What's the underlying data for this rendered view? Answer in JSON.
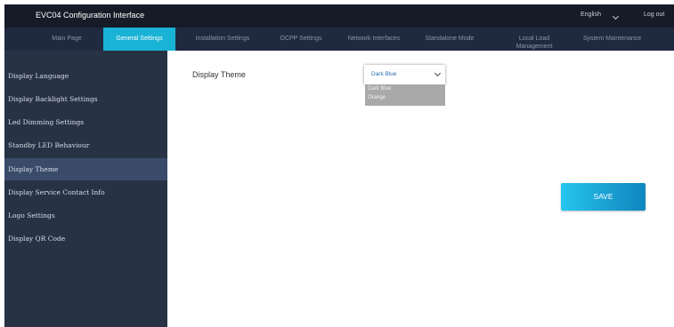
{
  "header": {
    "title": "EVC04 Configuration Interface",
    "language": "English",
    "logout_label": "Log out"
  },
  "nav": {
    "tabs": [
      {
        "label": "Main Page"
      },
      {
        "label": "General Settings"
      },
      {
        "label": "Installation Settings"
      },
      {
        "label": "OCPP Settings"
      },
      {
        "label": "Network Interfaces"
      },
      {
        "label": "Standalone Mode"
      },
      {
        "label": "Local Load Management"
      },
      {
        "label": "System Maintenance"
      }
    ],
    "active_tab": "General Settings"
  },
  "sidebar": {
    "items": [
      {
        "label": "Display Language"
      },
      {
        "label": "Display Backlight Settings"
      },
      {
        "label": "Led Dimming Settings"
      },
      {
        "label": "Standby LED Behaviour"
      },
      {
        "label": "Display Theme"
      },
      {
        "label": "Display Service Contact Info"
      },
      {
        "label": "Logo Settings"
      },
      {
        "label": "Display QR Code"
      }
    ],
    "active_item": "Display Theme"
  },
  "main": {
    "field_label": "Display Theme",
    "theme_select": {
      "value": "Dark Blue",
      "options": [
        "Dark Blue",
        "Orange"
      ]
    },
    "save_label": "SAVE"
  },
  "colors": {
    "accent": "#19b3d6",
    "topbar": "#151b27",
    "navbar": "#1f2940",
    "sidebar": "#283245",
    "sidebar_active": "#3a4b6a"
  }
}
